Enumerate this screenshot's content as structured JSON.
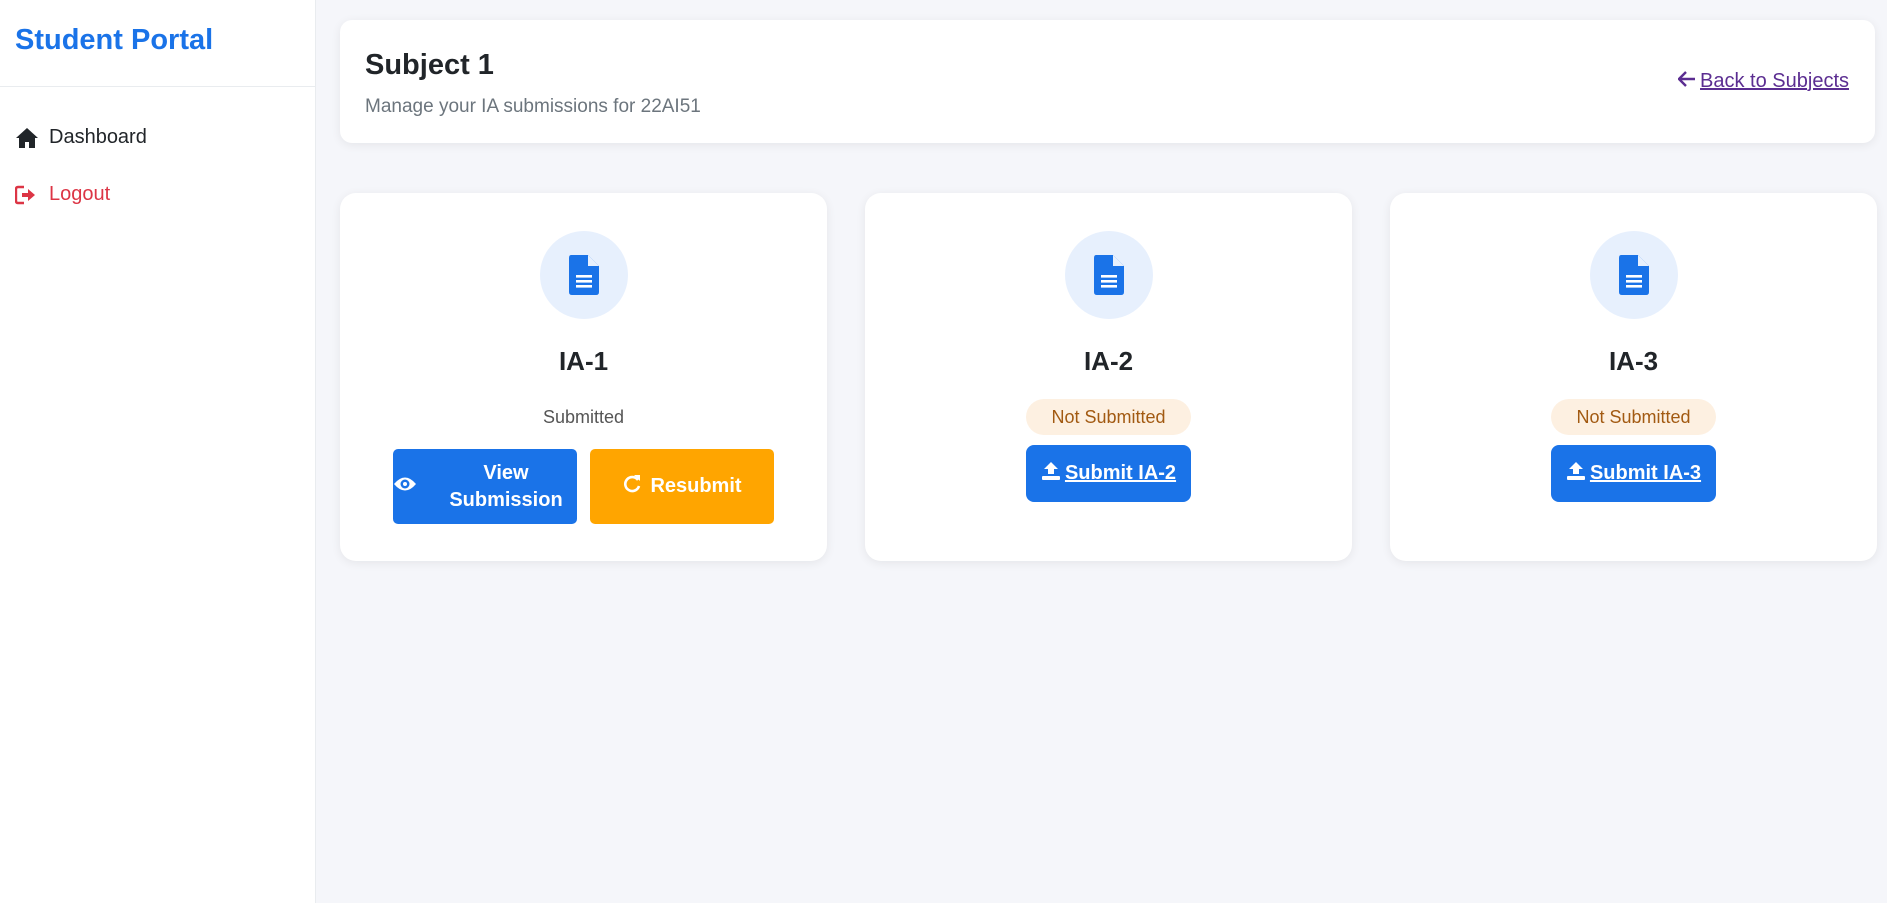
{
  "sidebar": {
    "brand": "Student Portal",
    "items": [
      {
        "label": "Dashboard",
        "icon": "home-icon"
      },
      {
        "label": "Logout",
        "icon": "logout-icon"
      }
    ]
  },
  "header": {
    "title": "Subject 1",
    "subtitle": "Manage your IA submissions for 22AI51",
    "back_label": " Back to Subjects"
  },
  "cards": [
    {
      "title": "IA-1",
      "status": "Submitted",
      "view_label": "View Submission",
      "resubmit_label": "Resubmit"
    },
    {
      "title": "IA-2",
      "status": "Not Submitted",
      "submit_label": " Submit IA-2"
    },
    {
      "title": "IA-3",
      "status": "Not Submitted",
      "submit_label": " Submit IA-3"
    }
  ],
  "colors": {
    "primary": "#1a73e8",
    "warning": "#ffa500",
    "danger": "#dc3545",
    "badge_bg": "#fdf0e1",
    "badge_text": "#a25a12",
    "link": "#5b2d91"
  }
}
